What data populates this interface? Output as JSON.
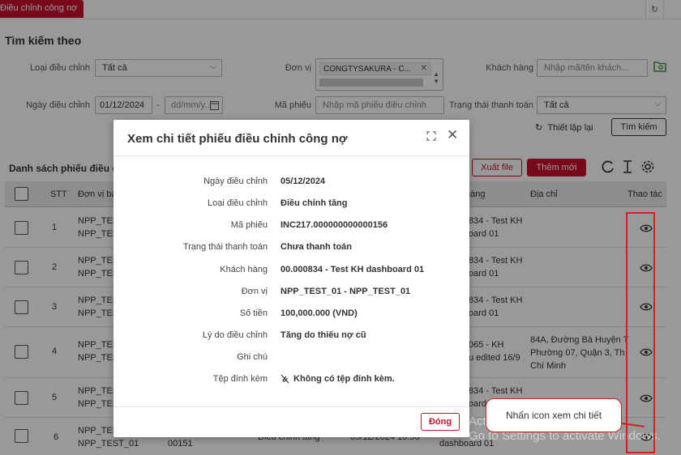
{
  "topbar": {
    "active_tab": "Điều chỉnh công nợ"
  },
  "search": {
    "title": "Tìm kiếm theo",
    "adjust_type_label": "Loại điều chỉnh",
    "adjust_type_value": "Tất cả",
    "unit_label": "Đơn vị",
    "unit_chip": "CONGTYSAKURA - C...",
    "customer_label": "Khách hàng",
    "customer_placeholder": "Nhập mã/tên khách...",
    "date_label": "Ngày điều chỉnh",
    "date_from": "01/12/2024",
    "date_sep": "-",
    "date_to_placeholder": "dd/mm/y...",
    "code_label": "Mã phiếu",
    "code_placeholder": "Nhập mã phiếu điều chỉnh",
    "payment_label": "Trạng thái thanh toán",
    "payment_value": "Tất cả",
    "reset_label": "Thiết lập lại",
    "search_button": "Tìm kiếm"
  },
  "list": {
    "title": "Danh sách phiếu điều ch",
    "export_button": "Xuất file",
    "add_button": "Thêm mới",
    "columns": {
      "stt": "STT",
      "unit": "Đơn vị bá",
      "customer": "hàng",
      "address": "Địa chỉ",
      "actions": "Thao tác"
    },
    "rows": [
      {
        "stt": "1",
        "unit1": "NPP_TES",
        "unit2": "NPP_TES",
        "cust1": "834 - Test KH",
        "cust2": "oard 01",
        "addr1": "",
        "addr2": "",
        "addr3": ""
      },
      {
        "stt": "2",
        "unit1": "NPP_TES",
        "unit2": "NPP_TES",
        "cust1": "834 - Test KH",
        "cust2": "oard 01",
        "addr1": "",
        "addr2": "",
        "addr3": ""
      },
      {
        "stt": "3",
        "unit1": "NPP_TES",
        "unit2": "NPP_TES",
        "cust1": "834 - Test KH",
        "cust2": "oard 01",
        "addr1": "",
        "addr2": "",
        "addr3": ""
      },
      {
        "stt": "4",
        "unit1": "NPP_TES",
        "unit2": "NPP_TES",
        "cust1": "065 - KH",
        "cust2": "u edited 16/9",
        "addr1": "84A, Đường Bà Huyện T",
        "addr2": "Phường 07, Quận 3, Th",
        "addr3": "Chí Minh"
      },
      {
        "stt": "5",
        "unit1": "NPP_TES",
        "unit2": "NPP_TES",
        "cust1": "834 - Test KH",
        "cust2": "oard 01",
        "addr1": "",
        "addr2": "",
        "addr3": ""
      },
      {
        "stt": "6",
        "unit1": "NPP_TEST_01",
        "unit2": "NPP_TEST_01",
        "code": "00151",
        "type": "Điều chỉnh tăng",
        "date": "05/12/2024 10:56",
        "cust1": "",
        "cust2": "dashboard 01",
        "addr1": "",
        "addr2": "",
        "addr3": ""
      }
    ]
  },
  "watermark": {
    "line1": "Activate Windows",
    "line2": "Go to Settings to activate Windows."
  },
  "callout": {
    "text": "Nhấn icon xem chi tiết"
  },
  "modal": {
    "title": "Xem chi tiết phiếu điều chỉnh công nợ",
    "fields": [
      {
        "label": "Ngày điều chỉnh",
        "value": "05/12/2024"
      },
      {
        "label": "Loại điều chỉnh",
        "value": "Điều chỉnh tăng"
      },
      {
        "label": "Mã phiếu",
        "value": "INC217.000000000000156"
      },
      {
        "label": "Trạng thái thanh toán",
        "value": "Chưa thanh toán"
      },
      {
        "label": "Khách hàng",
        "value": "00.000834 - Test KH dashboard 01"
      },
      {
        "label": "Đơn vị",
        "value": "NPP_TEST_01 - NPP_TEST_01"
      },
      {
        "label": "Số tiền",
        "value": "100,000.000 (VND)"
      },
      {
        "label": "Lý do điều chỉnh",
        "value": "Tăng do thiếu nợ cũ"
      },
      {
        "label": "Ghi chú",
        "value": ""
      },
      {
        "label": "Tệp đính kèm",
        "value": "Không có tệp đính kèm."
      }
    ],
    "close_button": "Đóng"
  },
  "colors": {
    "brand": "#c8102e",
    "highlight": "#d62020"
  }
}
